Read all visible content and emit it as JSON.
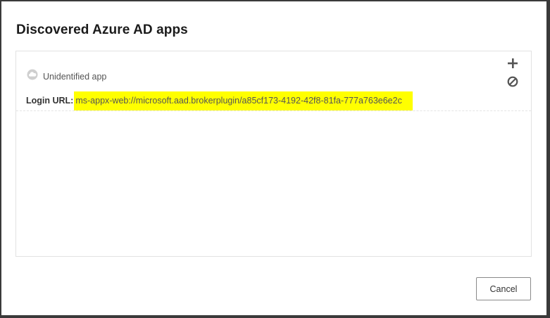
{
  "dialog": {
    "title": "Discovered Azure AD apps",
    "cancel_label": "Cancel"
  },
  "apps": [
    {
      "icon": "cloud-icon",
      "name": "Unidentified app",
      "login_label": "Login URL:",
      "login_url": "ms-appx-web://microsoft.aad.brokerplugin/a85cf173-4192-42f8-81fa-777a763e6e2c",
      "highlight_color": "#ffff00"
    }
  ],
  "actions": {
    "add_icon": "plus-icon",
    "block_icon": "block-icon"
  }
}
